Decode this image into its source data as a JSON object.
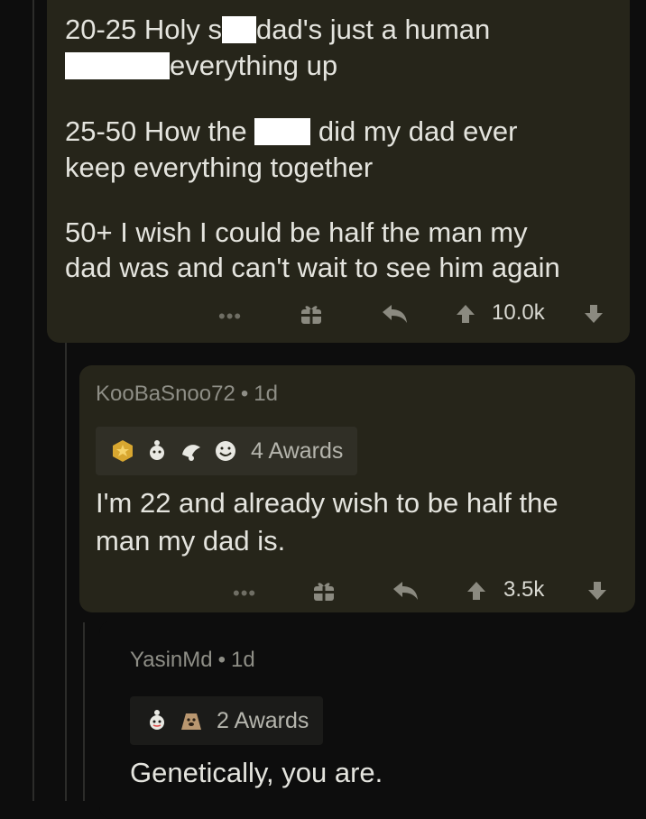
{
  "comment1": {
    "line1a": "20-25 Holy s",
    "line1b": "dad's just a human",
    "line2": "everything up",
    "line3a": "25-50 How the",
    "line3b": "did my dad ever",
    "line4": "keep everything together",
    "line5": "50+ I wish I could be half the man my",
    "line6": "dad was and can't wait to see him again",
    "score": "10.0k"
  },
  "comment2": {
    "username": "KooBaSnoo72",
    "separator": "•",
    "age": "1d",
    "awards_label": "4 Awards",
    "body_line1": "I'm 22 and already wish to be half the",
    "body_line2": "man my dad is.",
    "score": "3.5k"
  },
  "comment3": {
    "username": "YasinMd",
    "separator": "•",
    "age": "1d",
    "awards_label": "2 Awards",
    "body": "Genetically, you are."
  },
  "actions": {
    "more_glyph": "•••"
  },
  "colors": {
    "background": "#0d0d0d",
    "card": "#26251a",
    "text": "#e4e4de",
    "meta": "#8e8e86",
    "icon": "#8b8a80"
  }
}
